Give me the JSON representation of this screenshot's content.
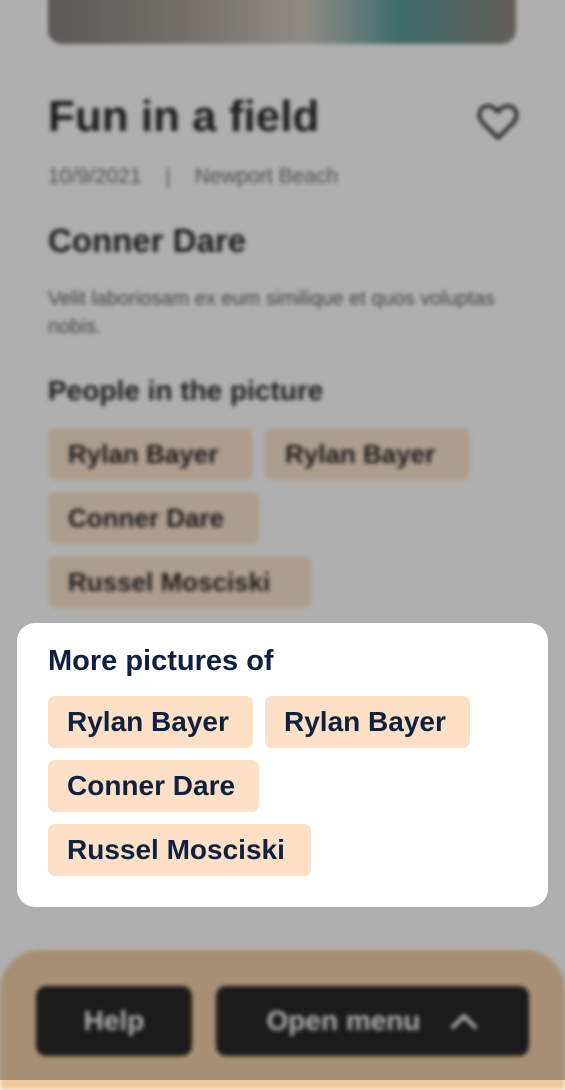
{
  "post": {
    "title": "Fun in a field",
    "date": "10/9/2021",
    "separator": "|",
    "location": "Newport Beach",
    "author": "Conner Dare",
    "description": "Velit laboriosam ex eum similique et quos voluptas nobis.",
    "people_heading": "People in the picture",
    "people": [
      "Rylan Bayer",
      "Rylan Bayer",
      "Conner Dare",
      "Russel Mosciski"
    ]
  },
  "bottom_bar": {
    "help_label": "Help",
    "menu_label": "Open menu"
  },
  "modal": {
    "title": "More pictures of",
    "people": [
      "Rylan Bayer",
      "Rylan Bayer",
      "Conner Dare",
      "Russel Mosciski"
    ]
  },
  "icons": {
    "favorite": "heart-outline-icon",
    "menu_toggle": "chevron-up-icon"
  },
  "colors": {
    "chip_background": "#fde0c5",
    "chip_text": "#0f2140",
    "bottom_bar": "#f0c89b",
    "button": "#000000",
    "overlay": "rgba(64,64,64,0.42)"
  }
}
